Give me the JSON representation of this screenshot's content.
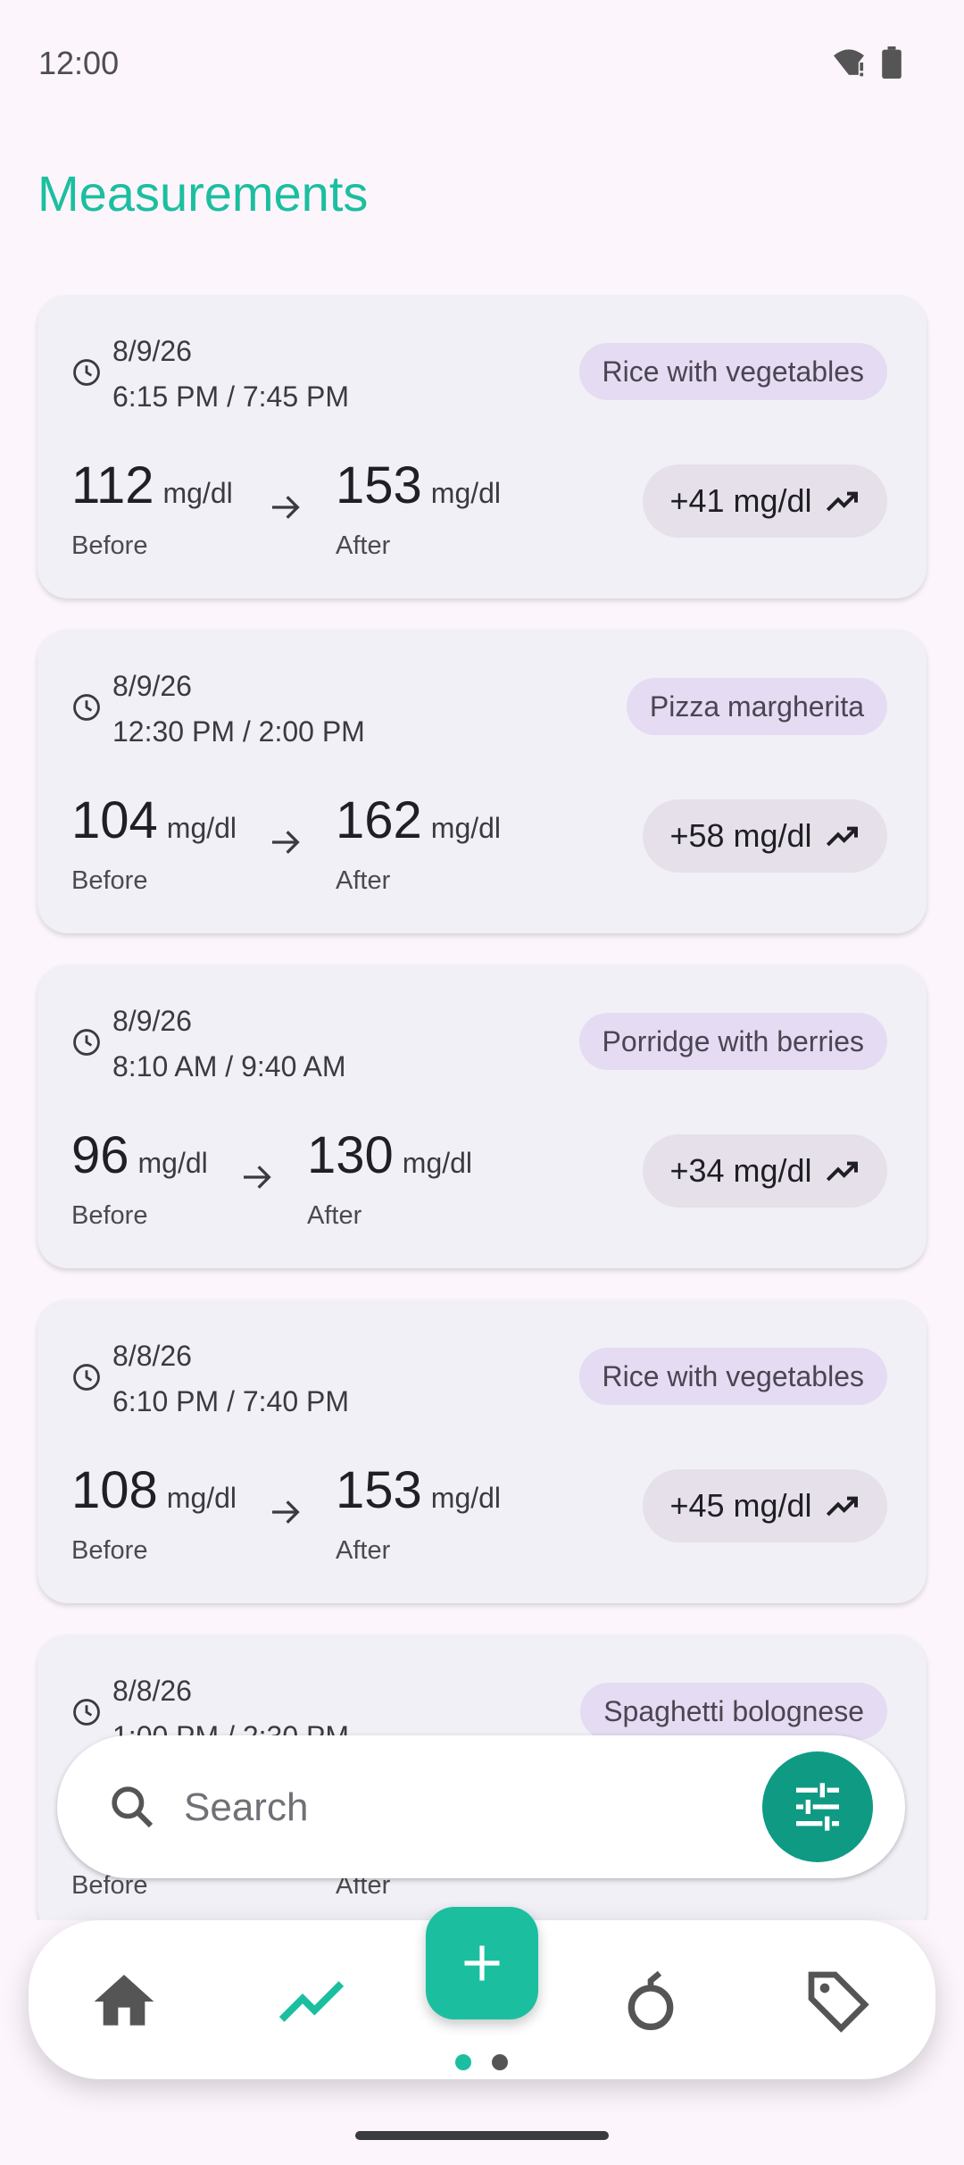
{
  "status_bar": {
    "time": "12:00",
    "icons": [
      "wifi-alert-icon",
      "battery-icon"
    ]
  },
  "page_title": "Measurements",
  "measurements": [
    {
      "date": "8/9/26",
      "times": "6:15 PM / 7:45 PM",
      "meal": "Rice with vegetables",
      "before": "112",
      "after": "153",
      "unit": "mg/dl",
      "before_label": "Before",
      "after_label": "After",
      "delta": "+41 mg/dl"
    },
    {
      "date": "8/9/26",
      "times": "12:30 PM / 2:00 PM",
      "meal": "Pizza margherita",
      "before": "104",
      "after": "162",
      "unit": "mg/dl",
      "before_label": "Before",
      "after_label": "After",
      "delta": "+58 mg/dl"
    },
    {
      "date": "8/9/26",
      "times": "8:10 AM / 9:40 AM",
      "meal": "Porridge with berries",
      "before": "96",
      "after": "130",
      "unit": "mg/dl",
      "before_label": "Before",
      "after_label": "After",
      "delta": "+34 mg/dl"
    },
    {
      "date": "8/8/26",
      "times": "6:10 PM / 7:40 PM",
      "meal": "Rice with vegetables",
      "before": "108",
      "after": "153",
      "unit": "mg/dl",
      "before_label": "Before",
      "after_label": "After",
      "delta": "+45 mg/dl"
    },
    {
      "date": "8/8/26",
      "times": "1:00 PM / 2:30 PM",
      "meal": "Spaghetti bolognese",
      "before": "",
      "after": "",
      "unit": "",
      "before_label": "Before",
      "after_label": "After",
      "delta": ""
    }
  ],
  "search": {
    "placeholder": "Search"
  },
  "nav": {
    "items": [
      "home-icon",
      "trend-icon",
      "apple-icon",
      "tag-icon"
    ],
    "active": "trend-icon",
    "page_count": 2,
    "active_page": 1
  },
  "colors": {
    "accent": "#1bbf9f",
    "accent_dark": "#0f9a84",
    "chip": "#e5dbf2",
    "card": "#f0f0f6",
    "background": "#fcf5fc"
  }
}
